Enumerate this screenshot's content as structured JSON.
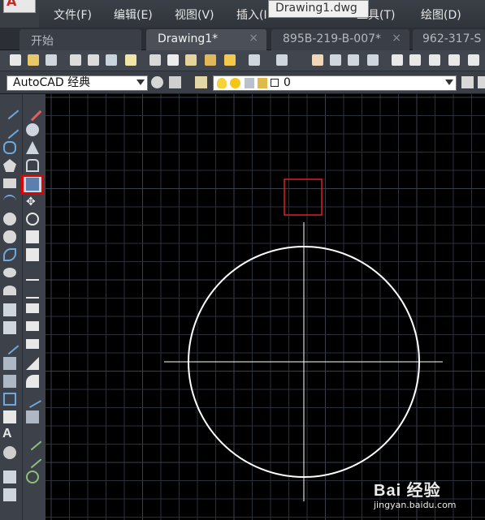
{
  "menubar": {
    "items": [
      {
        "label": "文件(F)"
      },
      {
        "label": "编辑(E)"
      },
      {
        "label": "视图(V)"
      },
      {
        "label": "插入(I"
      },
      {
        "label": "工具(T)"
      },
      {
        "label": "绘图(D)"
      }
    ],
    "window_title_tooltip": "Drawing1.dwg"
  },
  "tabs": [
    {
      "label": "开始",
      "active": false
    },
    {
      "label": "Drawing1*",
      "active": true
    },
    {
      "label": "895B-219-B-007*",
      "active": false
    },
    {
      "label": "962-317-S",
      "active": false
    }
  ],
  "tab_close_glyph": "×",
  "propbar": {
    "workspace": "AutoCAD 经典",
    "layer": "0"
  },
  "canvas": {
    "background": "#000000",
    "grid_color": "#2a2f38",
    "major_grid_color": "#3a404b",
    "entity_color": "#ffffff",
    "selection_box_color": "#e02020"
  },
  "watermark": {
    "brand": "Bai 经验",
    "url": "jingyan.baidu.com"
  },
  "colors": {
    "highlight": "#e30000"
  }
}
